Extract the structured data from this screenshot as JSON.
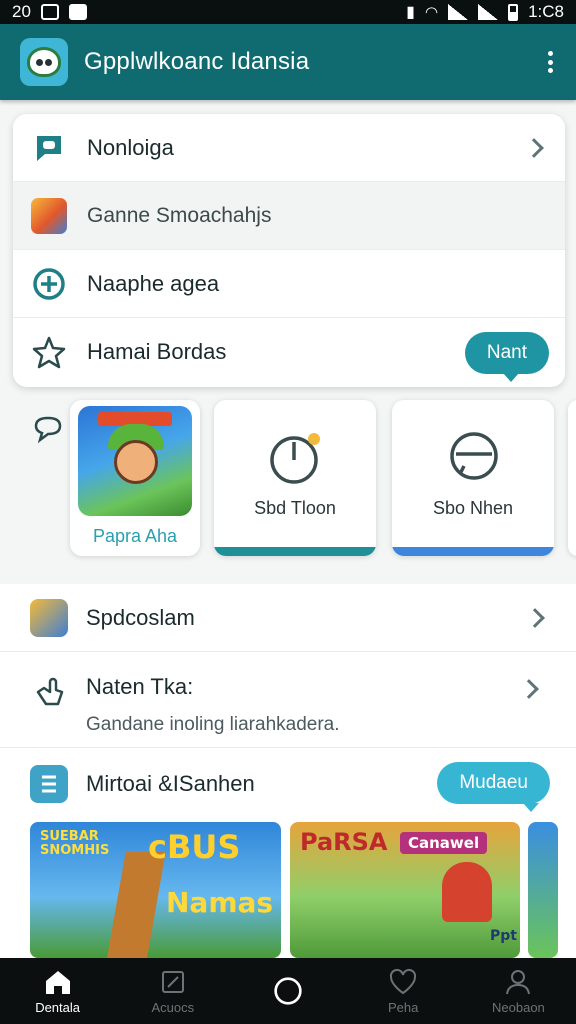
{
  "status_bar": {
    "left_number": "20",
    "time": "1:C8"
  },
  "app_bar": {
    "title": "Gpplwlkoanc Idansia",
    "overflow_icon": "more-vert-icon"
  },
  "menu": {
    "items": [
      {
        "icon": "chat-bubble-icon",
        "label": "Nonloiga",
        "has_chevron": true
      },
      {
        "icon": "game-thumbnail",
        "label": "Ganne Smoachahjs"
      },
      {
        "icon": "plus-circle-icon",
        "label": "Naaphe agea"
      },
      {
        "icon": "star-outline-icon",
        "label": "Hamai Bordas"
      }
    ],
    "next_button": "Nant"
  },
  "carousel": {
    "cards": [
      {
        "caption": "Papra Aha",
        "accent": "#2a9fb0"
      },
      {
        "caption": "Sbd Tloon",
        "accent": "#1f8f98"
      },
      {
        "caption": "Sbo Nhen",
        "accent": "#3e86dd"
      }
    ]
  },
  "list": {
    "row1": {
      "label": "Spdcoslam"
    },
    "row2": {
      "label": "Naten Tka:",
      "subtitle": "Gandane inoling liarahkadera."
    },
    "row3": {
      "label": "Mirtoai &ISanhen",
      "button": "Mudaeu"
    }
  },
  "banners": [
    {
      "top_text": "SUEBAR SNOMHIS",
      "big_text": "cBUS",
      "bottom_text": "Namas"
    },
    {
      "top_text": "PaRSA",
      "tag": "Canawel",
      "extra": "Ppt"
    }
  ],
  "bottom_nav": {
    "items": [
      {
        "label": "Dentala",
        "icon": "home-icon",
        "active": true
      },
      {
        "label": "Acuocs",
        "icon": "edit-icon",
        "active": false
      },
      {
        "label": "",
        "icon": "circle-home-icon",
        "active": false
      },
      {
        "label": "Peha",
        "icon": "heart-icon",
        "active": false
      },
      {
        "label": "Neobaon",
        "icon": "person-icon",
        "active": false
      }
    ]
  },
  "colors": {
    "primary": "#0f6b70",
    "accent": "#1f95a3",
    "pill_light": "#37b6d4"
  }
}
